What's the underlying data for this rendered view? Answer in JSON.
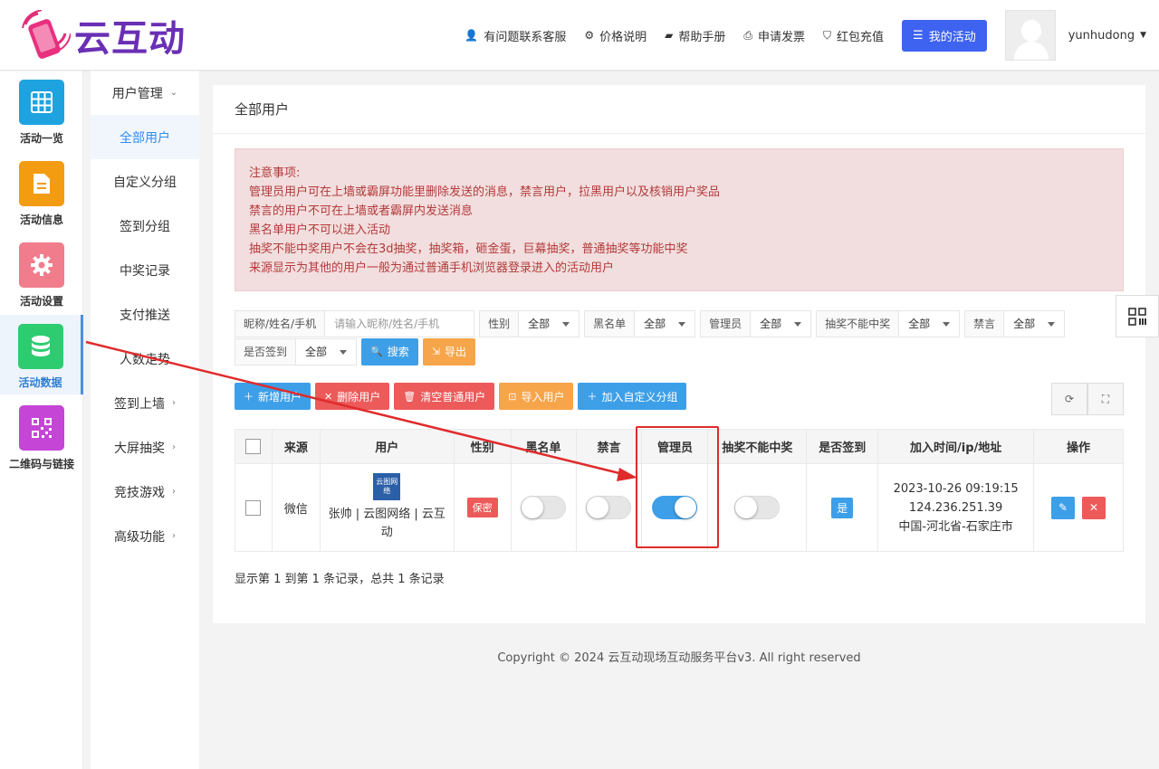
{
  "header": {
    "logo_text": "云互动",
    "nav": [
      {
        "icon": "user-plus-icon",
        "label": "有问题联系客服"
      },
      {
        "icon": "gear-icon",
        "label": "价格说明"
      },
      {
        "icon": "book-icon",
        "label": "帮助手册"
      },
      {
        "icon": "printer-icon",
        "label": "申请发票"
      },
      {
        "icon": "shield-check-icon",
        "label": "红包充值"
      }
    ],
    "my_activity": "我的活动",
    "username": "yunhudong"
  },
  "rail": [
    {
      "icon": "grid-icon",
      "label": "活动一览",
      "color": "#1ea3e0"
    },
    {
      "icon": "document-icon",
      "label": "活动信息",
      "color": "#f39c12"
    },
    {
      "icon": "settings-icon",
      "label": "活动设置",
      "color": "#f07c8c"
    },
    {
      "icon": "database-icon",
      "label": "活动数据",
      "color": "#2ecc71"
    },
    {
      "icon": "qrcode-icon",
      "label": "二维码与链接",
      "color": "#c545d6"
    }
  ],
  "subnav": [
    {
      "label": "用户管理",
      "chev": "⌄"
    },
    {
      "label": "全部用户",
      "chev": ""
    },
    {
      "label": "自定义分组",
      "chev": ""
    },
    {
      "label": "签到分组",
      "chev": ""
    },
    {
      "label": "中奖记录",
      "chev": ""
    },
    {
      "label": "支付推送",
      "chev": ""
    },
    {
      "label": "人数走势",
      "chev": ""
    },
    {
      "label": "签到上墙",
      "chev": "›"
    },
    {
      "label": "大屏抽奖",
      "chev": "›"
    },
    {
      "label": "竞技游戏",
      "chev": "›"
    },
    {
      "label": "高级功能",
      "chev": "›"
    }
  ],
  "page_title": "全部用户",
  "notice": [
    "注意事项:",
    "管理员用户可在上墙或霸屏功能里删除发送的消息，禁言用户，拉黑用户以及核销用户奖品",
    "禁言的用户不可在上墙或者霸屏内发送消息",
    "黑名单用户不可以进入活动",
    "抽奖不能中奖用户不会在3d抽奖，抽奖箱，砸金蛋，巨幕抽奖，普通抽奖等功能中奖",
    "来源显示为其他的用户一般为通过普通手机浏览器登录进入的活动用户"
  ],
  "filters": {
    "name_label": "昵称/姓名/手机",
    "name_placeholder": "请输入昵称/姓名/手机",
    "selects": [
      {
        "label": "性别",
        "value": "全部"
      },
      {
        "label": "黑名单",
        "value": "全部"
      },
      {
        "label": "管理员",
        "value": "全部"
      },
      {
        "label": "抽奖不能中奖",
        "value": "全部"
      },
      {
        "label": "禁言",
        "value": "全部"
      },
      {
        "label": "是否签到",
        "value": "全部"
      }
    ],
    "search": "搜索",
    "export": "导出"
  },
  "toolbar": {
    "add": "新增用户",
    "delete": "删除用户",
    "clear": "清空普通用户",
    "import": "导入用户",
    "add_group": "加入自定义分组"
  },
  "table": {
    "headers": [
      "来源",
      "用户",
      "性别",
      "黑名单",
      "禁言",
      "管理员",
      "抽奖不能中奖",
      "是否签到",
      "加入时间/ip/地址",
      "操作"
    ],
    "rows": [
      {
        "source": "微信",
        "user_logo": "云图网络",
        "user_name": "张帅 | 云图网络 | 云互动",
        "gender": "保密",
        "blacklist": false,
        "mute": false,
        "admin": true,
        "no_prize": false,
        "signed": "是",
        "time": "2023-10-26 09:19:15",
        "ip": "124.236.251.39",
        "address": "中国-河北省-石家庄市"
      }
    ]
  },
  "pager": "显示第 1 到第 1 条记录，总共 1 条记录",
  "footer": "Copyright © 2024 云互动现场互动服务平台v3. All right reserved"
}
